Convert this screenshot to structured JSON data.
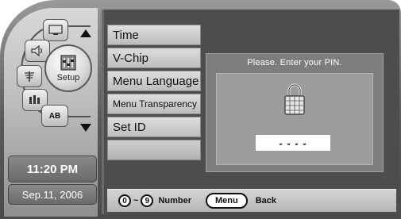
{
  "wheel": {
    "center_label": "Setup",
    "ab_label": "AB",
    "icons": [
      "tv-icon",
      "speaker-icon",
      "antenna-icon",
      "channel-icon"
    ]
  },
  "clock": {
    "time": "11:20 PM",
    "date": "Sep.11, 2006"
  },
  "menu": {
    "items": [
      {
        "label": "Time"
      },
      {
        "label": "V-Chip"
      },
      {
        "label": "Menu Language"
      },
      {
        "label": "Menu Transparency"
      },
      {
        "label": "Set ID"
      },
      {
        "label": ""
      }
    ]
  },
  "dialog": {
    "title": "Please. Enter your PIN.",
    "pin": "- - - -"
  },
  "bottom_bar": {
    "num_start": "0",
    "tilde": "~",
    "num_end": "9",
    "number_label": "Number",
    "menu_key": "Menu",
    "back_label": "Back"
  }
}
